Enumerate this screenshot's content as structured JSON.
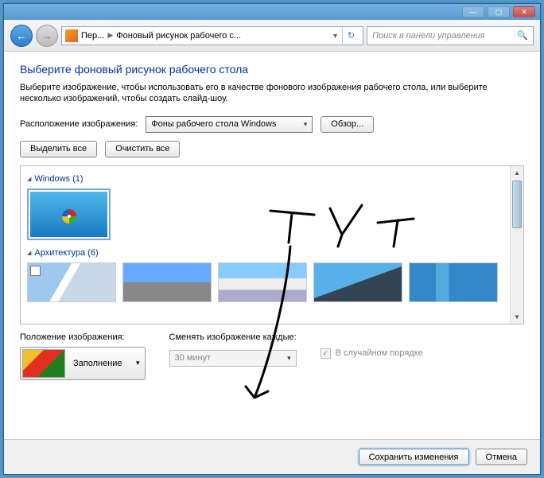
{
  "titlebar": {
    "min": "—",
    "max": "▢",
    "close": "✕"
  },
  "nav": {
    "crumb1": "Пер...",
    "crumb2": "Фоновый рисунок рабочего с...",
    "search_placeholder": "Поиск в панели управления"
  },
  "page": {
    "title": "Выберите фоновый рисунок рабочего стола",
    "desc": "Выберите изображение, чтобы использовать его в качестве фонового изображения рабочего стола, или выберите несколько изображений, чтобы создать слайд-шоу."
  },
  "location": {
    "label": "Расположение изображения:",
    "value": "Фоны рабочего стола Windows",
    "browse": "Обзор..."
  },
  "selectAll": "Выделить все",
  "clearAll": "Очистить все",
  "groups": {
    "g1": "Windows (1)",
    "g2": "Архитектура (6)"
  },
  "position": {
    "label": "Положение изображения:",
    "value": "Заполнение"
  },
  "interval": {
    "label": "Сменять изображение каждые:",
    "value": "30 минут"
  },
  "shuffle": {
    "label": "В случайном порядке"
  },
  "footer": {
    "save": "Сохранить изменения",
    "cancel": "Отмена"
  }
}
